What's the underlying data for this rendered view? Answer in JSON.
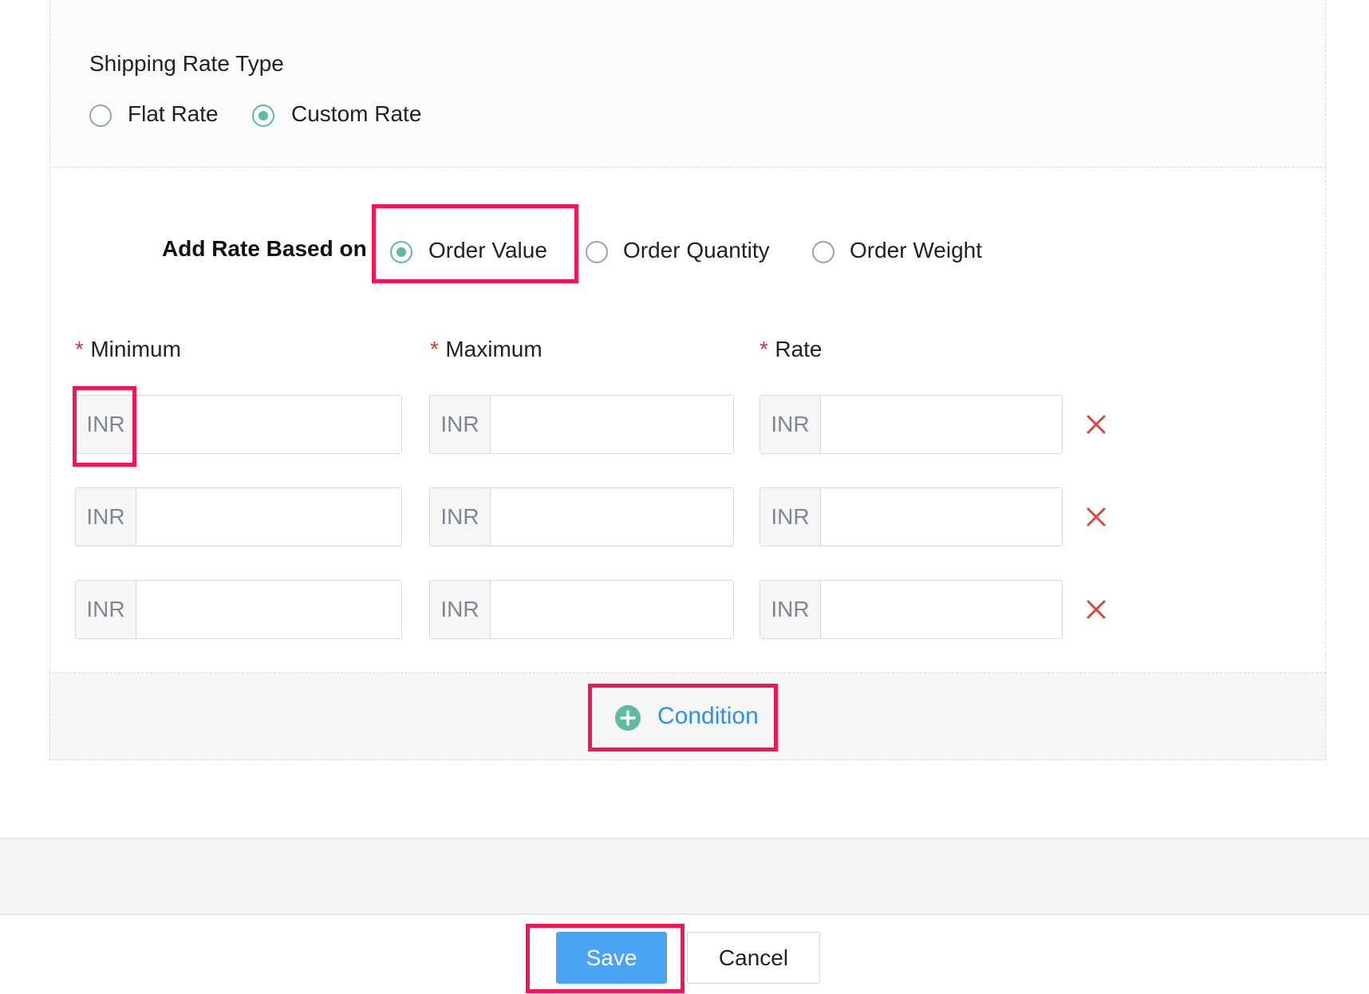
{
  "shipping_rate_type": {
    "title": "Shipping Rate Type",
    "options": [
      {
        "label": "Flat Rate",
        "selected": false
      },
      {
        "label": "Custom Rate",
        "selected": true
      }
    ]
  },
  "rate_basis": {
    "label": "Add Rate Based on",
    "options": [
      {
        "label": "Order Value",
        "selected": true
      },
      {
        "label": "Order Quantity",
        "selected": false
      },
      {
        "label": "Order Weight",
        "selected": false
      }
    ]
  },
  "columns": {
    "required_mark": "*",
    "minimum": "Minimum",
    "maximum": "Maximum",
    "rate": "Rate"
  },
  "rows": [
    {
      "minimum": {
        "currency": "INR",
        "value": ""
      },
      "maximum": {
        "currency": "INR",
        "value": ""
      },
      "rate": {
        "currency": "INR",
        "value": ""
      }
    },
    {
      "minimum": {
        "currency": "INR",
        "value": ""
      },
      "maximum": {
        "currency": "INR",
        "value": ""
      },
      "rate": {
        "currency": "INR",
        "value": ""
      }
    },
    {
      "minimum": {
        "currency": "INR",
        "value": ""
      },
      "maximum": {
        "currency": "INR",
        "value": ""
      },
      "rate": {
        "currency": "INR",
        "value": ""
      }
    }
  ],
  "add_condition": {
    "label": "Condition",
    "icon": "plus-circle-icon"
  },
  "actions": {
    "save": "Save",
    "cancel": "Cancel"
  },
  "colors": {
    "accent_green": "#5dbba2",
    "link_blue": "#2f8ff0",
    "save_blue": "#4aa3f3",
    "remove_red": "#d9483b",
    "highlight": "#ee1856"
  }
}
